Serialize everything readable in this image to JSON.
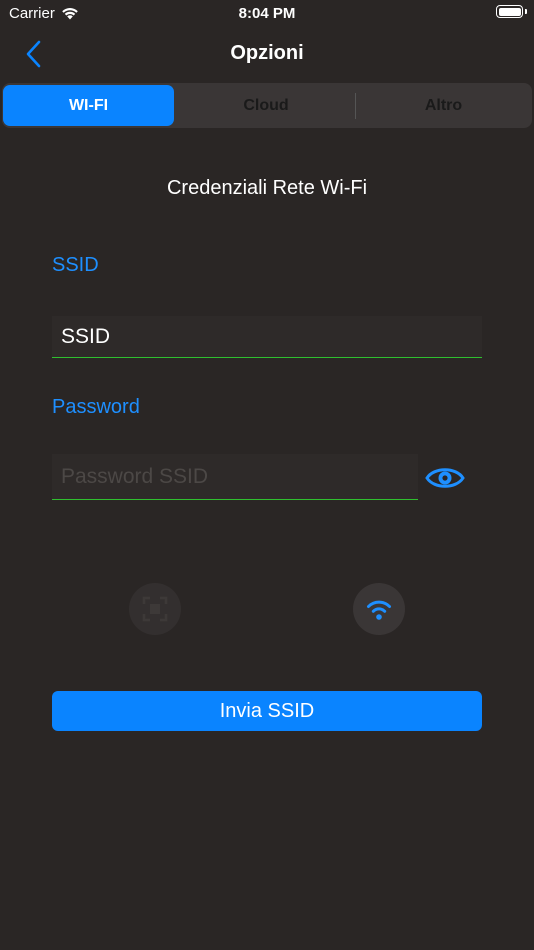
{
  "status_bar": {
    "carrier": "Carrier",
    "time": "8:04 PM"
  },
  "nav": {
    "title": "Opzioni",
    "back_icon": "chevron-left-icon"
  },
  "tabs": [
    {
      "label": "WI-FI",
      "active": true
    },
    {
      "label": "Cloud",
      "active": false
    },
    {
      "label": "Altro",
      "active": false
    }
  ],
  "form": {
    "title": "Credenziali Rete Wi-Fi",
    "ssid_label": "SSID",
    "ssid_value": "SSID",
    "password_label": "Password",
    "password_placeholder": "Password SSID",
    "password_value": "",
    "submit_label": "Invia SSID"
  },
  "actions": {
    "scan_icon": "scan-icon",
    "wifi_icon": "wifi-icon"
  },
  "colors": {
    "accent": "#0a84ff",
    "label_blue": "#1e8fff",
    "underline_green": "#2fbf2f",
    "background": "#2a2625"
  }
}
